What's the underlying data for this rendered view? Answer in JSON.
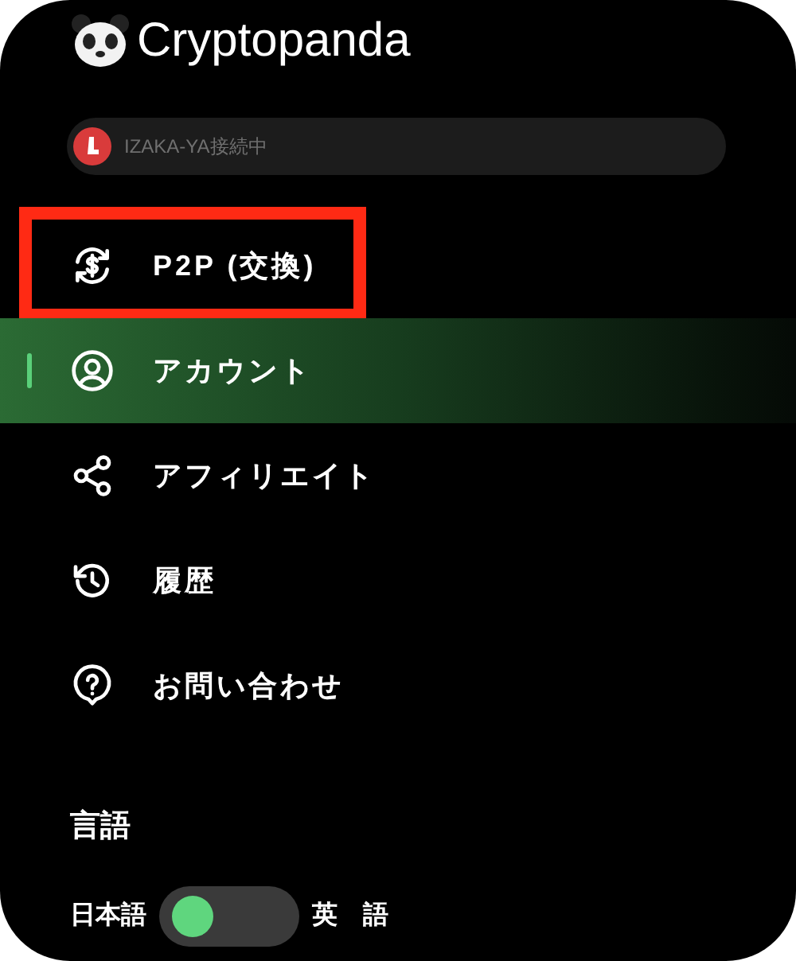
{
  "brand": {
    "name": "Cryptopanda"
  },
  "status": {
    "text": "IZAKA-YA接続中"
  },
  "menu": [
    {
      "label": "P2P (交換)",
      "selected": false,
      "highlighted": true
    },
    {
      "label": "アカウント",
      "selected": true,
      "highlighted": false
    },
    {
      "label": "アフィリエイト",
      "selected": false,
      "highlighted": false
    },
    {
      "label": "履歴",
      "selected": false,
      "highlighted": false
    },
    {
      "label": "お問い合わせ",
      "selected": false,
      "highlighted": false
    }
  ],
  "language": {
    "heading": "言語",
    "left_label": "日本語",
    "right_label": "英　語",
    "switch": {
      "on": false
    }
  }
}
